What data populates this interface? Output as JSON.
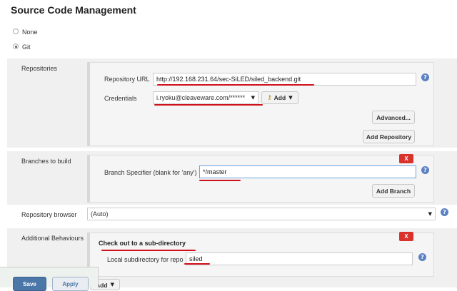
{
  "page": {
    "title": "Source Code Management"
  },
  "scm_options": [
    {
      "label": "None",
      "selected": false
    },
    {
      "label": "Git",
      "selected": true
    }
  ],
  "repositories": {
    "section_label": "Repositories",
    "repo_url_label": "Repository URL",
    "repo_url_value": "http://192.168.231.64/sec-SiLED/siled_backend.git",
    "credentials_label": "Credentials",
    "credentials_value": "i.ryoku@cleaveware.com/******",
    "add_label": "Add",
    "advanced_label": "Advanced...",
    "add_repository_label": "Add Repository"
  },
  "branches": {
    "section_label": "Branches to build",
    "specifier_label": "Branch Specifier (blank for 'any')",
    "specifier_value": "*/master",
    "delete_label": "X",
    "add_branch_label": "Add Branch"
  },
  "repo_browser": {
    "label": "Repository browser",
    "value": "(Auto)"
  },
  "behaviours": {
    "section_label": "Additional Behaviours",
    "behaviour_title": "Check out to a sub-directory",
    "delete_label": "X",
    "local_subdir_label": "Local subdirectory for repo",
    "local_subdir_value": "siled",
    "add_label": "Add"
  },
  "footer": {
    "save_label": "Save",
    "apply_label": "Apply"
  },
  "help_glyph": "?",
  "colors": {
    "annotation_red": "#d0101c",
    "save_blue": "#4b76a8",
    "delete_red": "#d9322b"
  }
}
